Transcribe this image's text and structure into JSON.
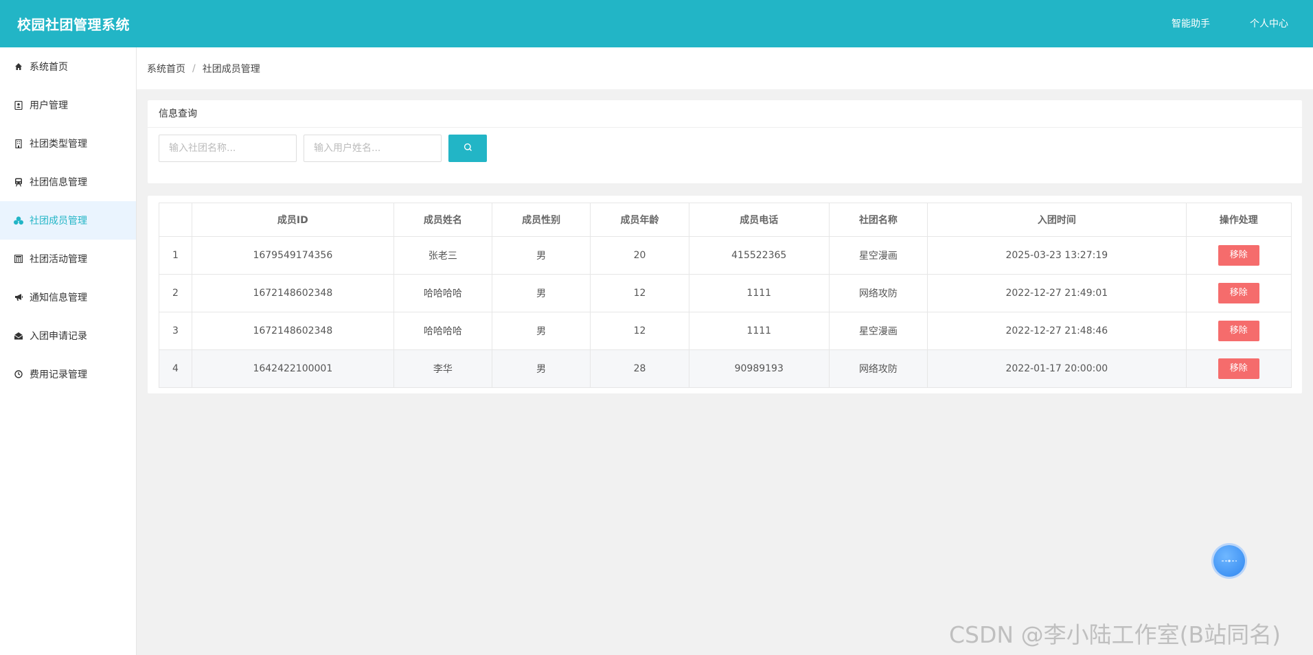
{
  "app": {
    "title": "校园社团管理系统"
  },
  "topnav": {
    "assistant": "智能助手",
    "profile": "个人中心"
  },
  "sidebar": {
    "items": [
      {
        "label": "系统首页",
        "icon": "home-icon"
      },
      {
        "label": "用户管理",
        "icon": "user-card-icon"
      },
      {
        "label": "社团类型管理",
        "icon": "building-icon"
      },
      {
        "label": "社团信息管理",
        "icon": "train-icon"
      },
      {
        "label": "社团成员管理",
        "icon": "cubes-icon",
        "active": true
      },
      {
        "label": "社团活动管理",
        "icon": "calculator-icon"
      },
      {
        "label": "通知信息管理",
        "icon": "bullhorn-icon"
      },
      {
        "label": "入团申请记录",
        "icon": "envelope-open-icon"
      },
      {
        "label": "费用记录管理",
        "icon": "clock-icon"
      }
    ]
  },
  "breadcrumb": {
    "home": "系统首页",
    "separator": "/",
    "current": "社团成员管理"
  },
  "query": {
    "title": "信息查询",
    "club_placeholder": "输入社团名称...",
    "user_placeholder": "输入用户姓名..."
  },
  "table": {
    "headers": [
      "",
      "成员ID",
      "成员姓名",
      "成员性别",
      "成员年龄",
      "成员电话",
      "社团名称",
      "入团时间",
      "操作处理"
    ],
    "rows": [
      {
        "idx": "1",
        "id": "1679549174356",
        "name": "张老三",
        "gender": "男",
        "age": "20",
        "phone": "415522365",
        "club": "星空漫画",
        "time": "2025-03-23 13:27:19",
        "action": "移除"
      },
      {
        "idx": "2",
        "id": "1672148602348",
        "name": "哈哈哈哈",
        "gender": "男",
        "age": "12",
        "phone": "1111",
        "club": "网络攻防",
        "time": "2022-12-27 21:49:01",
        "action": "移除"
      },
      {
        "idx": "3",
        "id": "1672148602348",
        "name": "哈哈哈哈",
        "gender": "男",
        "age": "12",
        "phone": "1111",
        "club": "星空漫画",
        "time": "2022-12-27 21:48:46",
        "action": "移除"
      },
      {
        "idx": "4",
        "id": "1642422100001",
        "name": "李华",
        "gender": "男",
        "age": "28",
        "phone": "90989193",
        "club": "网络攻防",
        "time": "2022-01-17 20:00:00",
        "action": "移除"
      }
    ]
  },
  "watermark": "CSDN @李小陆工作室(B站同名)",
  "colors": {
    "primary": "#22b5c6",
    "danger": "#f56c6c",
    "active_bg": "#eaf4fe"
  }
}
